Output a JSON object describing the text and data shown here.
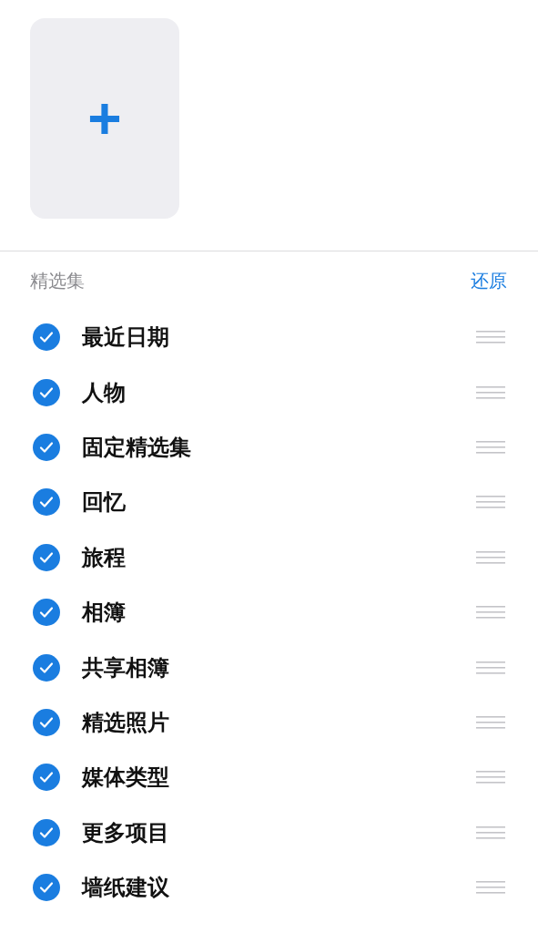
{
  "add_tile": {
    "icon": "+"
  },
  "section": {
    "title": "精选集",
    "action": "还原"
  },
  "items": [
    {
      "label": "最近日期",
      "checked": true
    },
    {
      "label": "人物",
      "checked": true
    },
    {
      "label": "固定精选集",
      "checked": true
    },
    {
      "label": "回忆",
      "checked": true
    },
    {
      "label": "旅程",
      "checked": true
    },
    {
      "label": "相簿",
      "checked": true
    },
    {
      "label": "共享相簿",
      "checked": true
    },
    {
      "label": "精选照片",
      "checked": true
    },
    {
      "label": "媒体类型",
      "checked": true
    },
    {
      "label": "更多项目",
      "checked": true
    },
    {
      "label": "墙纸建议",
      "checked": true
    }
  ]
}
